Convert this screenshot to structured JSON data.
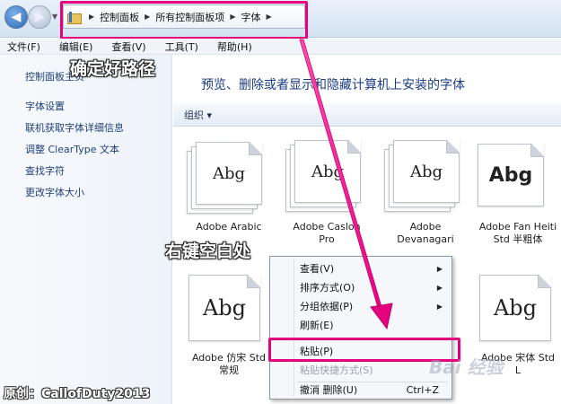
{
  "nav": {
    "back_glyph": "◀",
    "forward_glyph": "▶"
  },
  "address": {
    "crumbs": [
      "控制面板",
      "所有控制面板项",
      "字体"
    ]
  },
  "menu": [
    "文件(F)",
    "编辑(E)",
    "查看(V)",
    "工具(T)",
    "帮助(H)"
  ],
  "sidebar": {
    "home": "控制面板主页",
    "links": [
      "字体设置",
      "联机获取字体详细信息",
      "调整 ClearType 文本",
      "查找字符",
      "更改字体大小"
    ]
  },
  "main": {
    "headline": "预览、删除或者显示和隐藏计算机上安装的字体",
    "organize": "组织 ▾",
    "sample": "Abg",
    "fonts": [
      {
        "line1": "Adobe Arabic",
        "line2": ""
      },
      {
        "line1": "Adobe Caslon",
        "line2": "Pro"
      },
      {
        "line1": "Adobe",
        "line2": "Devanagari"
      },
      {
        "line1": "Adobe Fan Heiti",
        "line2": "Std 半粗体"
      },
      {
        "line1": "Adobe 仿宋 Std",
        "line2": "常规"
      },
      {
        "line1": "",
        "line2": ""
      },
      {
        "line1": "",
        "line2": ""
      },
      {
        "line1": "Adobe 宋体 Std",
        "line2": "L"
      }
    ]
  },
  "context_menu": {
    "items": [
      {
        "label": "查看(V)",
        "submenu": true
      },
      {
        "label": "排序方式(O)",
        "submenu": true
      },
      {
        "label": "分组依据(P)",
        "submenu": true
      },
      {
        "label": "刷新(E)",
        "submenu": false
      },
      {
        "label": "粘贴(P)",
        "submenu": false
      },
      {
        "label": "粘贴快捷方式(S)",
        "submenu": false,
        "disabled": true
      },
      {
        "label": "撤消 删除(U)",
        "submenu": false,
        "accel": "Ctrl+Z"
      }
    ]
  },
  "annotations": {
    "path": "确定好路径",
    "right_click": "右键空白处",
    "author": "原创：CallofDuty2013",
    "watermark": "Bai 经验"
  },
  "colors": {
    "highlight": "#e5007e",
    "link": "#1e3f7a",
    "headline": "#1a3c84"
  }
}
